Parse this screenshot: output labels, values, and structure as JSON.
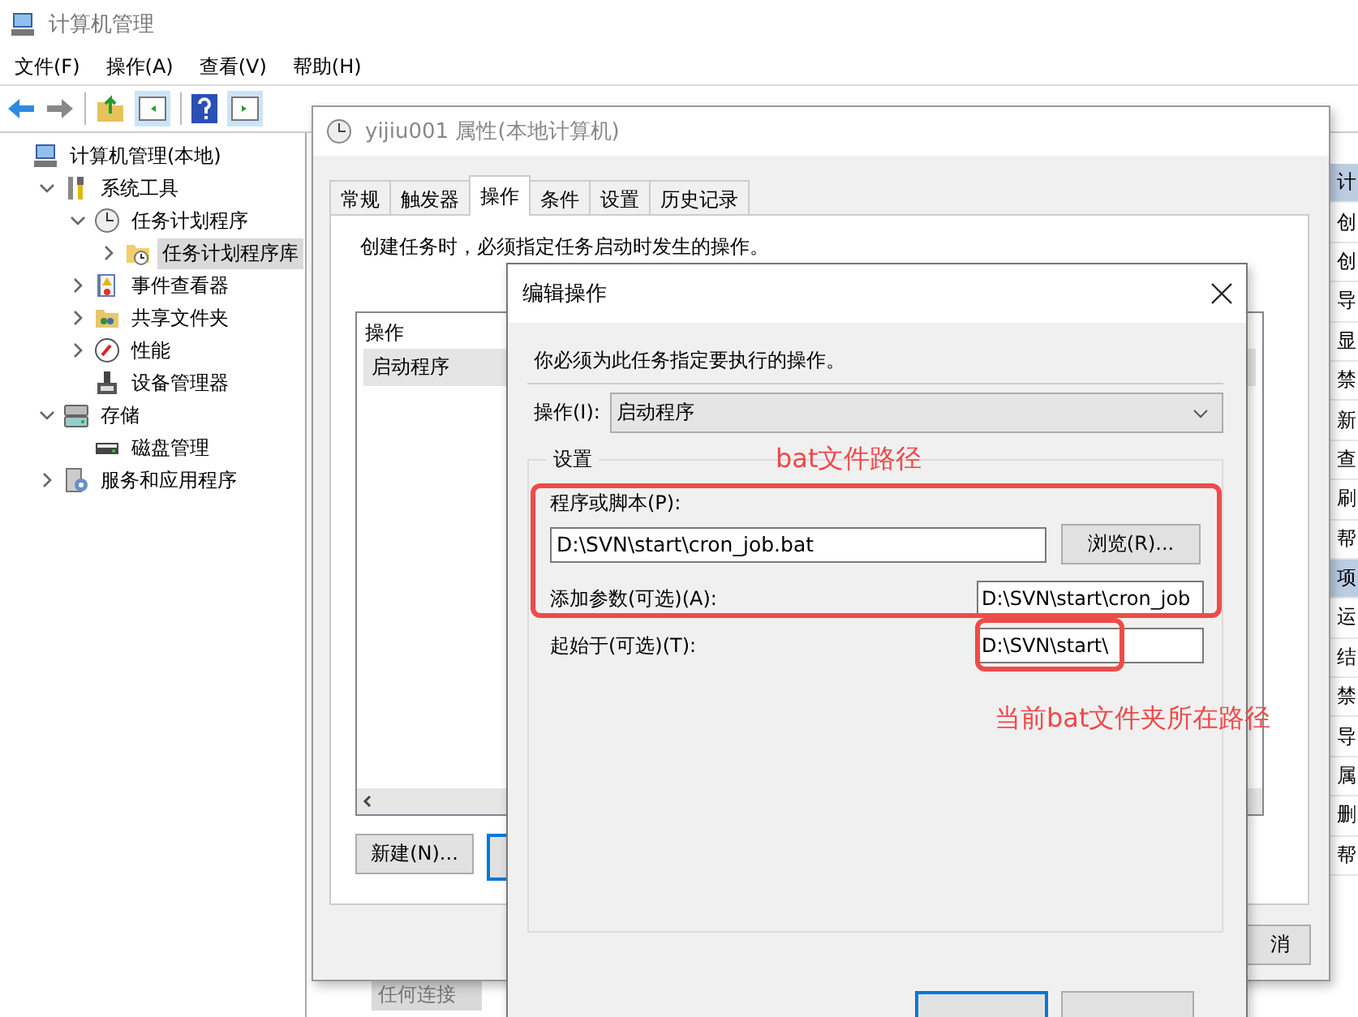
{
  "main_window": {
    "title": "计算机管理",
    "menu": [
      "文件(F)",
      "操作(A)",
      "查看(V)",
      "帮助(H)"
    ]
  },
  "tree": [
    {
      "label": "计算机管理(本地)",
      "kind": "computer",
      "selected": false,
      "children": [
        {
          "label": "系统工具",
          "kind": "tools",
          "expanded": true,
          "selected": false,
          "children": [
            {
              "label": "任务计划程序",
              "kind": "clock",
              "expanded": true,
              "selected": false,
              "children": [
                {
                  "label": "任务计划程序库",
                  "kind": "folder-clock",
                  "expanded": false,
                  "selected": true
                }
              ]
            },
            {
              "label": "事件查看器",
              "kind": "event-log",
              "expanded": false,
              "selected": false
            },
            {
              "label": "共享文件夹",
              "kind": "shared-folder",
              "expanded": false,
              "selected": false
            },
            {
              "label": "性能",
              "kind": "performance",
              "expanded": false,
              "selected": false
            },
            {
              "label": "设备管理器",
              "kind": "device",
              "selected": false
            }
          ]
        },
        {
          "label": "存储",
          "kind": "storage",
          "expanded": true,
          "selected": false,
          "children": [
            {
              "label": "磁盘管理",
              "kind": "disk",
              "selected": false
            }
          ]
        },
        {
          "label": "服务和应用程序",
          "kind": "services",
          "expanded": false,
          "selected": false
        }
      ]
    }
  ],
  "center_pane": {
    "items": [
      "任何连接"
    ]
  },
  "actions": [
    {
      "label": "计",
      "kind": "header"
    },
    {
      "label": "创",
      "kind": "item"
    },
    {
      "label": "创",
      "kind": "item"
    },
    {
      "label": "导",
      "kind": "item"
    },
    {
      "label": "显",
      "kind": "item"
    },
    {
      "label": "禁",
      "kind": "item"
    },
    {
      "label": "新",
      "kind": "item"
    },
    {
      "label": "查",
      "kind": "item"
    },
    {
      "label": "刷",
      "kind": "item"
    },
    {
      "label": "帮",
      "kind": "item"
    },
    {
      "label": "项",
      "kind": "header"
    },
    {
      "label": "运",
      "kind": "item"
    },
    {
      "label": "结",
      "kind": "item"
    },
    {
      "label": "禁",
      "kind": "item"
    },
    {
      "label": "导",
      "kind": "item"
    },
    {
      "label": "属",
      "kind": "item"
    },
    {
      "label": "删",
      "kind": "item"
    },
    {
      "label": "帮",
      "kind": "item"
    }
  ],
  "properties_dialog": {
    "title": "yijiu001 属性(本地计算机)",
    "tabs": [
      {
        "label": "常规",
        "selected": false
      },
      {
        "label": "触发器",
        "selected": false
      },
      {
        "label": "操作",
        "selected": true
      },
      {
        "label": "条件",
        "selected": false
      },
      {
        "label": "设置",
        "selected": false
      },
      {
        "label": "历史记录",
        "selected": false
      }
    ],
    "description": "创建任务时，必须指定任务启动时发生的操作。",
    "list": {
      "columns": [
        "操作"
      ],
      "rows": [
        {
          "cells": [
            "启动程序"
          ],
          "selected": true
        }
      ]
    },
    "buttons": [
      "新建(N)..."
    ],
    "cancel_button": "消"
  },
  "edit_dialog": {
    "title": "编辑操作",
    "instruction": "你必须为此任务指定要执行的操作。",
    "action_label": "操作(I):",
    "action_value": "启动程序",
    "group": "设置",
    "program_label": "程序或脚本(P):",
    "program_value": "D:\\SVN\\start\\cron_job.bat",
    "browse_button": "浏览(R)...",
    "arguments_label": "添加参数(可选)(A):",
    "arguments_value": "D:\\SVN\\start\\cron_job",
    "start_in_label": "起始于(可选)(T):",
    "start_in_value": "D:\\SVN\\start\\"
  },
  "annotations": [
    {
      "text": "bat文件路径",
      "kind": "top"
    },
    {
      "text": "当前bat文件夹所在路径",
      "kind": "bottom"
    }
  ]
}
